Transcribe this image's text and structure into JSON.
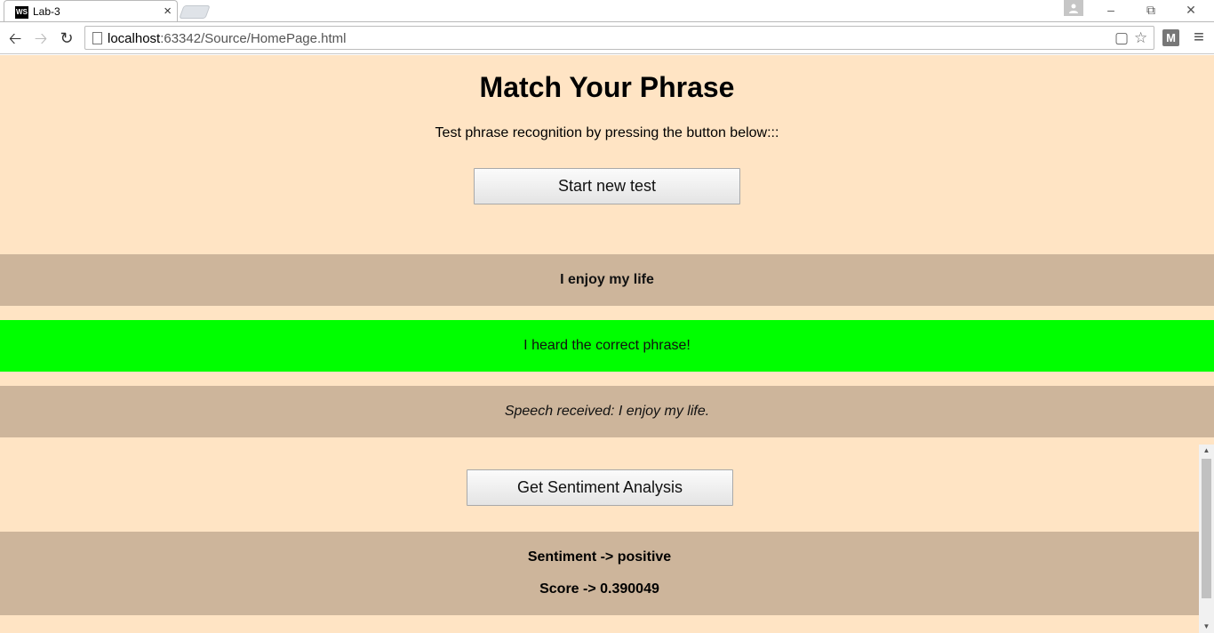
{
  "browser": {
    "tab_title": "Lab-3",
    "favicon_text": "WS",
    "url_host": "localhost",
    "url_rest": ":63342/Source/HomePage.html",
    "extension_label": "M"
  },
  "page": {
    "heading": "Match Your Phrase",
    "subtitle": "Test phrase recognition by pressing the button below:::",
    "start_button": "Start new test",
    "target_phrase": "I enjoy my life",
    "match_message": "I heard the correct phrase!",
    "speech_received": "Speech received: I enjoy my life.",
    "sentiment_button": "Get Sentiment Analysis",
    "sentiment_line": "Sentiment -> positive",
    "score_line": "Score -> 0.390049"
  },
  "colors": {
    "page_background": "#ffe4c4",
    "band_tan": "#cdb59b",
    "band_success": "#00ff00"
  }
}
